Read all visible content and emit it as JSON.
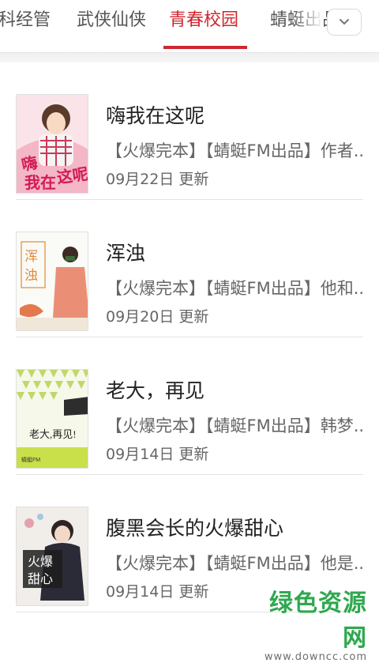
{
  "tabs": [
    {
      "label": "科经管",
      "active": false
    },
    {
      "label": "武侠仙侠",
      "active": false
    },
    {
      "label": "青春校园",
      "active": true
    },
    {
      "label": "蜻蜓出品",
      "active": false
    }
  ],
  "expand_icon": "chevron-down-icon",
  "accent_color": "#d0262f",
  "books": [
    {
      "title": "嗨我在这呢",
      "description": "【火爆完本】【蜻蜓FM出品】作者...",
      "update": "09月22日 更新",
      "cover_text": "嗨我在这呢"
    },
    {
      "title": "浑浊",
      "description": "【火爆完本】【蜻蜓FM出品】他和...",
      "update": "09月20日 更新",
      "cover_text": "浑浊"
    },
    {
      "title": "老大，再见",
      "description": "【火爆完本】【蜻蜓FM出品】韩梦...",
      "update": "09月14日 更新",
      "cover_text": "老大，再见!"
    },
    {
      "title": "腹黑会长的火爆甜心",
      "description": "【火爆完本】【蜻蜓FM出品】他是...",
      "update": "09月14日 更新",
      "cover_text": "火爆甜心"
    }
  ],
  "watermark": {
    "main": "绿色资源网",
    "sub": "www.downcc.com"
  }
}
